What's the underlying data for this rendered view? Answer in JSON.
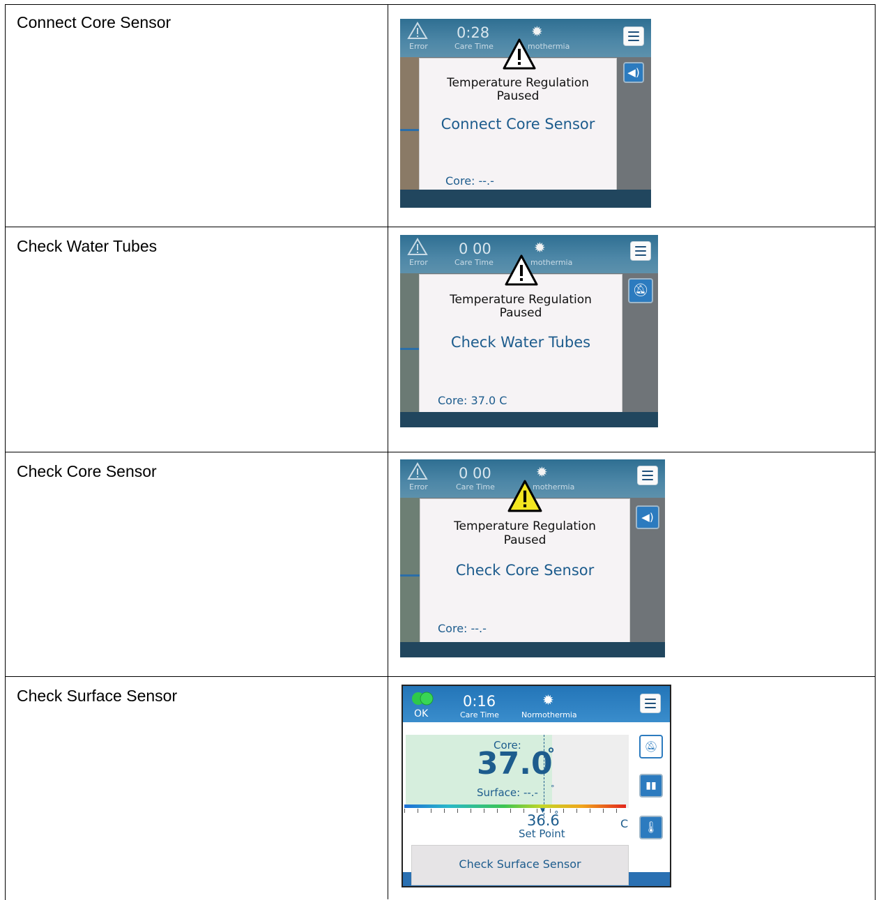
{
  "rows": [
    {
      "label": "Connect Core Sensor",
      "screen": {
        "status": "Error",
        "time": "0:28",
        "time_caption": "Care Time",
        "mode": "mothermia",
        "dialog_title_1": "Temperature Regulation",
        "dialog_title_2": "Paused",
        "dialog_message": "Connect Core Sensor",
        "core": "Core: --.-",
        "side_icon": "speaker-icon"
      }
    },
    {
      "label": "Check Water Tubes",
      "screen": {
        "status": "Error",
        "time": "0 00",
        "time_caption": "Care Time",
        "mode": "mothermia",
        "dialog_title_1": "Temperature Regulation",
        "dialog_title_2": "Paused",
        "dialog_message": "Check Water Tubes",
        "core": "Core: 37.0 C",
        "side_icon": "alarm-silenced-icon"
      }
    },
    {
      "label": "Check Core Sensor",
      "screen": {
        "status": "Error",
        "time": "0 00",
        "time_caption": "Care Time",
        "mode": "mothermia",
        "dialog_title_1": "Temperature Regulation",
        "dialog_title_2": "Paused",
        "dialog_message": "Check Core Sensor",
        "core": "Core: --.-",
        "side_icon": "speaker-icon",
        "warning_color": "#f3e620"
      }
    },
    {
      "label": "Check Surface Sensor",
      "screen": {
        "status": "OK",
        "time": "0:16",
        "time_caption": "Care Time",
        "mode": "Normothermia",
        "core_label": "Core:",
        "core_value": "37.0",
        "degree": "°",
        "surface_label": "Surface: --.-",
        "surface_degree": "°",
        "set_point_value": "36.6",
        "set_point_degree": "°",
        "set_point_label": "Set Point",
        "unit": "C",
        "message": "Check Surface Sensor"
      }
    }
  ],
  "colors": {
    "accent_blue": "#1d5c8d",
    "error_bar": "#2f6f92",
    "ok_bar": "#2375b8",
    "ok_green": "#2ec94a"
  }
}
